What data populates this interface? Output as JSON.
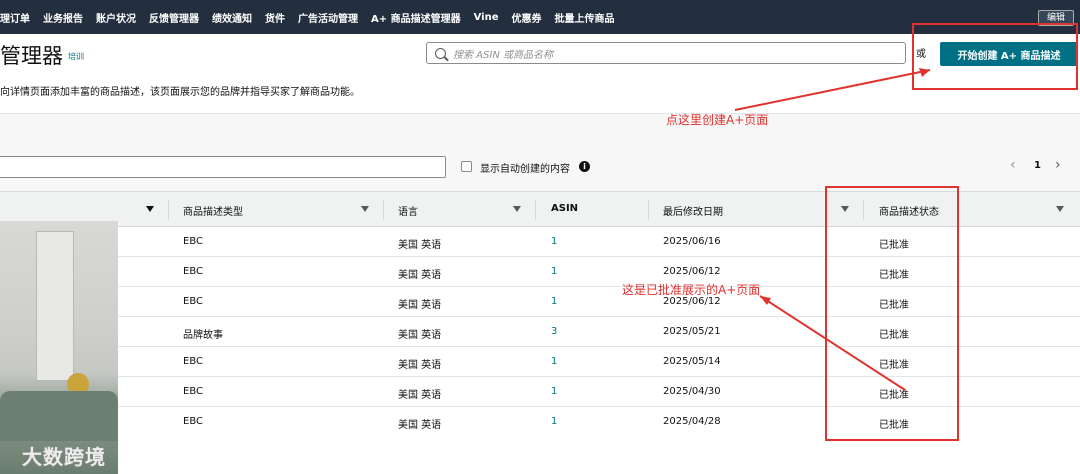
{
  "topnav": {
    "items": [
      "理订单",
      "业务报告",
      "账户状况",
      "反馈管理器",
      "绩效通知",
      "货件",
      "广告活动管理",
      "A+ 商品描述管理器",
      "Vine",
      "优惠券",
      "批量上传商品"
    ],
    "edit_label": "编辑"
  },
  "header": {
    "title": "管理器",
    "training_link": "培训",
    "search_placeholder": "搜索 ASIN 或商品名称",
    "or_text": "或",
    "create_button": "开始创建 A+ 商品描述"
  },
  "description": "向详情页面添加丰富的商品描述，该页面展示您的品牌并指导买家了解商品功能。",
  "filter": {
    "checkbox_label": "显示自动创建的内容",
    "info_icon": "info-icon",
    "page": "1",
    "prev_icon": "‹",
    "next_icon": "›"
  },
  "table": {
    "columns": [
      "商品描述类型",
      "语言",
      "ASIN",
      "最后修改日期",
      "商品描述状态"
    ],
    "rows": [
      {
        "type": "EBC",
        "language": "美国 英语",
        "asin": "1",
        "date": "2025/06/16",
        "status": "已批准"
      },
      {
        "type": "EBC",
        "language": "美国 英语",
        "asin": "1",
        "date": "2025/06/12",
        "status": "已批准"
      },
      {
        "type": "EBC",
        "language": "美国 英语",
        "asin": "1",
        "date": "2025/06/12",
        "status": "已批准"
      },
      {
        "type": "品牌故事",
        "language": "美国 英语",
        "asin": "3",
        "date": "2025/05/21",
        "status": "已批准"
      },
      {
        "type": "EBC",
        "language": "美国 英语",
        "asin": "1",
        "date": "2025/05/14",
        "status": "已批准"
      },
      {
        "type": "EBC",
        "language": "美国 英语",
        "asin": "1",
        "date": "2025/04/30",
        "status": "已批准"
      },
      {
        "type": "EBC",
        "language": "美国 英语",
        "asin": "1",
        "date": "2025/04/28",
        "status": "已批准"
      }
    ]
  },
  "annotations": {
    "create_hint": "点这里创建A+页面",
    "status_hint": "这是已批准展示的A+页面",
    "color": "#e0322e"
  },
  "watermark": "大数跨境",
  "colors": {
    "nav_bg": "#232f3e",
    "accent": "#007185"
  }
}
